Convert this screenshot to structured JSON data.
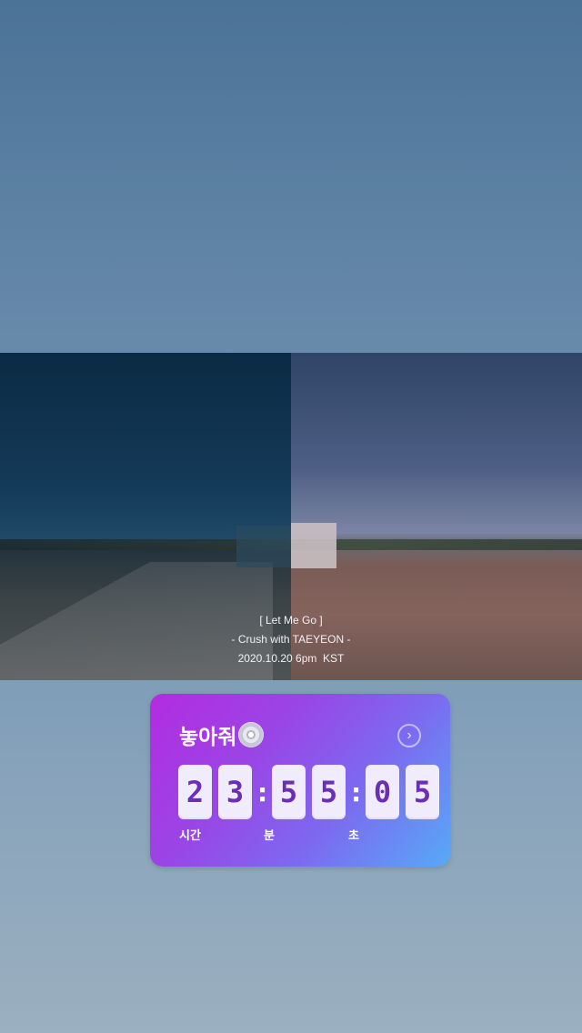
{
  "post": {
    "caption_lines": [
      "[ Let Me Go ]",
      "- Crush with TAEYEON -",
      "2020.10.20 6pm  KST"
    ]
  },
  "countdown": {
    "title": "놓아줘",
    "title_icon": "disc-icon",
    "action_icon": "chevron-right-icon",
    "hours": [
      "2",
      "3"
    ],
    "minutes": [
      "5",
      "5"
    ],
    "seconds": [
      "0",
      "5"
    ],
    "separator": ":",
    "labels": {
      "hours": "시간",
      "minutes": "분",
      "seconds": "초"
    },
    "gradient_start": "#b32ce0",
    "gradient_end": "#56aaf7",
    "digit_color": "#6a2fb4"
  }
}
